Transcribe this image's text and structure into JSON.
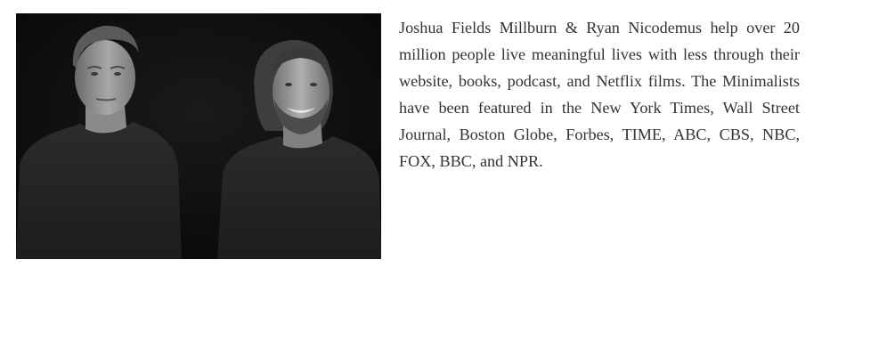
{
  "bio": {
    "text": "Joshua Fields Millburn & Ryan Nicodemus help over 20 million people live meaningful lives with less through their website, books, podcast, and Netflix films. The Minimalists have been featured in the New York Times, Wall Street Journal, Boston Globe, Forbes, TIME, ABC, CBS, NBC, FOX, BBC, and NPR."
  },
  "photo": {
    "style": "black-and-white",
    "subjects": 2
  },
  "colors": {
    "text": "#333333",
    "background": "#ffffff",
    "photo_background": "#0e0e0e"
  }
}
